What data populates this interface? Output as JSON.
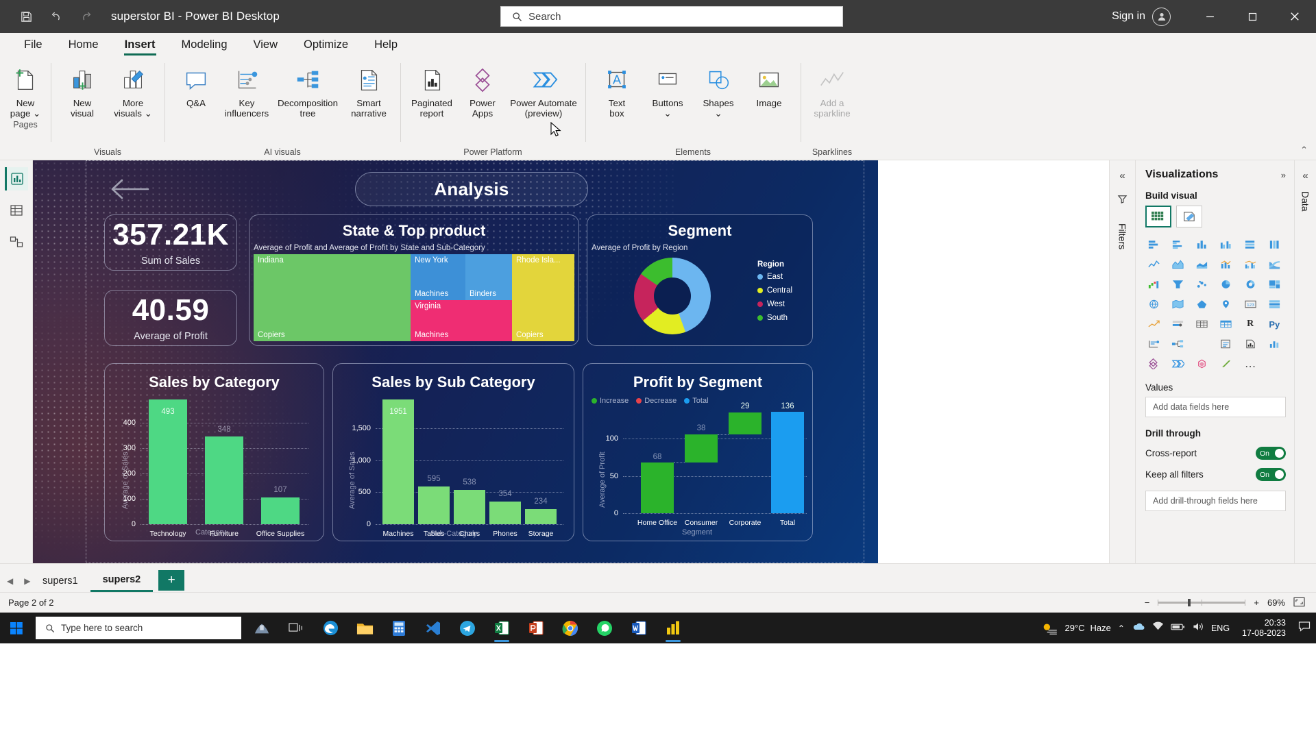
{
  "titlebar": {
    "save_icon": "save-icon",
    "undo_icon": "undo-icon",
    "redo_icon": "redo-icon",
    "title": "superstor BI - Power BI Desktop",
    "search_placeholder": "Search",
    "sign_in": "Sign in",
    "minimize": "minimize-button",
    "maximize": "maximize-button",
    "close": "close-button"
  },
  "ribbon": {
    "tabs": [
      {
        "label": "File",
        "active": false
      },
      {
        "label": "Home",
        "active": false
      },
      {
        "label": "Insert",
        "active": true
      },
      {
        "label": "Modeling",
        "active": false
      },
      {
        "label": "View",
        "active": false
      },
      {
        "label": "Optimize",
        "active": false
      },
      {
        "label": "Help",
        "active": false
      }
    ],
    "groups": [
      {
        "name": "Pages",
        "items": [
          {
            "label": "New\npage ⌄",
            "icon": "new-page-icon"
          }
        ]
      },
      {
        "name": "Visuals",
        "items": [
          {
            "label": "New\nvisual",
            "icon": "new-visual-icon"
          },
          {
            "label": "More\nvisuals ⌄",
            "icon": "more-visuals-icon"
          }
        ]
      },
      {
        "name": "AI visuals",
        "items": [
          {
            "label": "Q&A",
            "icon": "qa-icon"
          },
          {
            "label": "Key\ninfluencers",
            "icon": "key-influencers-icon"
          },
          {
            "label": "Decomposition\ntree",
            "icon": "decomposition-tree-icon"
          },
          {
            "label": "Smart\nnarrative",
            "icon": "smart-narrative-icon"
          }
        ]
      },
      {
        "name": "Power Platform",
        "items": [
          {
            "label": "Paginated\nreport",
            "icon": "paginated-report-icon"
          },
          {
            "label": "Power\nApps",
            "icon": "power-apps-icon"
          },
          {
            "label": "Power Automate\n(preview)",
            "icon": "power-automate-icon"
          }
        ]
      },
      {
        "name": "Elements",
        "items": [
          {
            "label": "Text\nbox",
            "icon": "text-box-icon"
          },
          {
            "label": "Buttons\n⌄",
            "icon": "buttons-icon"
          },
          {
            "label": "Shapes\n⌄",
            "icon": "shapes-icon"
          },
          {
            "label": "Image",
            "icon": "image-icon"
          }
        ]
      },
      {
        "name": "Sparklines",
        "items": [
          {
            "label": "Add a\nsparkline",
            "icon": "sparkline-icon",
            "disabled": true
          }
        ]
      }
    ]
  },
  "left_rail": [
    {
      "name": "report-view",
      "icon": "report-chart-icon",
      "active": true
    },
    {
      "name": "data-view",
      "icon": "table-grid-icon",
      "active": false
    },
    {
      "name": "model-view",
      "icon": "model-relationship-icon",
      "active": false
    }
  ],
  "report": {
    "banner_title": "Analysis",
    "back_button": "back-arrow-icon",
    "kpi_cards": [
      {
        "value": "357.21K",
        "label": "Sum of Sales"
      },
      {
        "value": "40.59",
        "label": "Average of Profit"
      }
    ],
    "treemap": {
      "title": "State & Top product",
      "subtitle": "Average of Profit and Average of Profit by State and Sub-Category",
      "tiles": [
        {
          "state": "Indiana",
          "product": "Copiers",
          "color": "#6cc767"
        },
        {
          "state": "New York",
          "product": "Machines",
          "color": "#3d90d7"
        },
        {
          "state": "",
          "product": "Binders",
          "color": "#4c9fdf"
        },
        {
          "state": "Rhode Isla...",
          "product": "Copiers",
          "color": "#e3d53b"
        },
        {
          "state": "Virginia",
          "product": "Machines",
          "color": "#ef2d73"
        }
      ]
    },
    "donut": {
      "title": "Segment",
      "subtitle": "Average of Profit by Region",
      "legend_title": "Region",
      "legend": [
        {
          "label": "East",
          "color": "#6cb6f0"
        },
        {
          "label": "Central",
          "color": "#e2ed22"
        },
        {
          "label": "West",
          "color": "#c6245c"
        },
        {
          "label": "South",
          "color": "#3cbd2e"
        }
      ]
    },
    "sales_by_category": {
      "title": "Sales by Category",
      "xlabel": "Category",
      "ylabel": "Average of Sales",
      "yticks": [
        "0",
        "100",
        "200",
        "300",
        "400"
      ],
      "categories": [
        "Technology",
        "Furniture",
        "Office Supplies"
      ],
      "values": [
        493,
        348,
        107
      ]
    },
    "sales_by_subcategory": {
      "title": "Sales by Sub Category",
      "xlabel": "Sub-Category",
      "ylabel": "Average of Sales",
      "yticks": [
        "0",
        "500",
        "1,000",
        "1,500"
      ],
      "categories": [
        "Machines",
        "Tables",
        "Chairs",
        "Phones",
        "Storage"
      ],
      "values": [
        1951,
        595,
        538,
        354,
        234
      ]
    },
    "profit_by_segment": {
      "title": "Profit by Segment",
      "xlabel": "Segment",
      "ylabel": "Average of Profit",
      "yticks": [
        "0",
        "50",
        "100"
      ],
      "legend": [
        {
          "label": "Increase",
          "color": "#2bb32b"
        },
        {
          "label": "Decrease",
          "color": "#e8424a"
        },
        {
          "label": "Total",
          "color": "#1b9df0"
        }
      ],
      "categories": [
        "Home Office",
        "Consumer",
        "Corporate",
        "Total"
      ],
      "values": [
        68,
        38,
        29,
        136
      ]
    }
  },
  "chart_data": [
    {
      "type": "bar",
      "title": "Sales by Category",
      "xlabel": "Category",
      "ylabel": "Average of Sales",
      "categories": [
        "Technology",
        "Furniture",
        "Office Supplies"
      ],
      "values": [
        493,
        348,
        107
      ],
      "ylim": [
        0,
        493
      ],
      "yticks": [
        0,
        100,
        200,
        300,
        400
      ],
      "grid": true,
      "legend": "none",
      "series_color": "#4ed884"
    },
    {
      "type": "bar",
      "title": "Sales by Sub Category",
      "xlabel": "Sub-Category",
      "ylabel": "Average of Sales",
      "categories": [
        "Machines",
        "Tables",
        "Chairs",
        "Phones",
        "Storage"
      ],
      "values": [
        1951,
        595,
        538,
        354,
        234
      ],
      "ylim": [
        0,
        1951
      ],
      "yticks": [
        0,
        500,
        1000,
        1500
      ],
      "grid": true,
      "legend": "none",
      "series_color": "#7bdc78"
    },
    {
      "type": "bar",
      "title": "Profit by Segment",
      "subtype": "waterfall",
      "xlabel": "Segment",
      "ylabel": "Average of Profit",
      "categories": [
        "Home Office",
        "Consumer",
        "Corporate",
        "Total"
      ],
      "values": [
        68,
        38,
        29,
        136
      ],
      "cumulative_base": [
        0,
        68,
        106,
        0
      ],
      "ylim": [
        0,
        136
      ],
      "yticks": [
        0,
        50,
        100
      ],
      "grid": true,
      "legend": [
        "Increase",
        "Decrease",
        "Total"
      ],
      "legend_position": "top-left"
    },
    {
      "type": "pie",
      "subtype": "donut",
      "title": "Segment",
      "subtitle": "Average of Profit by Region",
      "legend_title": "Region",
      "categories": [
        "East",
        "Central",
        "West",
        "South"
      ],
      "values": [
        45,
        20,
        22,
        13
      ],
      "colors": [
        "#6cb6f0",
        "#e2ed22",
        "#c6245c",
        "#3cbd2e"
      ],
      "legend_position": "right"
    },
    {
      "type": "heatmap",
      "subtype": "treemap",
      "title": "State & Top product",
      "subtitle": "Average of Profit and Average of Profit by State and Sub-Category",
      "categories": [
        "Indiana / Copiers",
        "New York / Machines",
        "New York / Binders",
        "Rhode Isla... / Copiers",
        "Virginia / Machines"
      ],
      "values": [
        44,
        16,
        12,
        14,
        14
      ],
      "colors": [
        "#6cc767",
        "#3d90d7",
        "#4c9fdf",
        "#e3d53b",
        "#ef2d73"
      ]
    }
  ],
  "right_strip": {
    "collapse_icon": "chevron-double-left-icon",
    "filter_icon": "filter-icon",
    "filters_label": "Filters"
  },
  "visualizations": {
    "title": "Visualizations",
    "expand_icon": "chevron-double-right-icon",
    "build_visual": "Build visual",
    "values_label": "Values",
    "values_placeholder": "Add data fields here",
    "drill_through_label": "Drill through",
    "cross_report_label": "Cross-report",
    "cross_report_state": "On",
    "keep_filters_label": "Keep all filters",
    "keep_filters_state": "On",
    "drill_placeholder": "Add drill-through fields here",
    "gallery_icons": [
      "stacked-bar-chart-icon",
      "clustered-bar-chart-icon",
      "stacked-column-chart-icon",
      "clustered-column-chart-icon",
      "100-stacked-bar-icon",
      "100-stacked-column-icon",
      "line-chart-icon",
      "area-chart-icon",
      "stacked-area-chart-icon",
      "line-stacked-column-icon",
      "line-clustered-column-icon",
      "ribbon-chart-icon",
      "waterfall-chart-icon",
      "funnel-chart-icon",
      "scatter-chart-icon",
      "pie-chart-icon",
      "donut-chart-icon",
      "treemap-icon",
      "map-icon",
      "filled-map-icon",
      "shape-map-icon",
      "azure-map-icon",
      "card-icon",
      "multi-row-card-icon",
      "kpi-icon",
      "slicer-icon",
      "table-icon",
      "matrix-icon",
      "r-script-visual-icon",
      "python-visual-icon",
      "key-influencers-icon",
      "decomposition-tree-icon",
      "qa-visual-icon",
      "smart-narrative-icon",
      "paginated-report-icon",
      "metrics-icon",
      "power-apps-icon",
      "power-automate-icon",
      "scatter-hex-icon",
      "arrow-visual-icon",
      "more-options-icon"
    ]
  },
  "data_pane": {
    "label": "Data",
    "collapse_icon": "chevron-double-left-icon"
  },
  "page_tabs": {
    "prev_icon": "prev-page-icon",
    "next_icon": "next-page-icon",
    "tabs": [
      {
        "label": "supers1",
        "active": false
      },
      {
        "label": "supers2",
        "active": true
      }
    ],
    "add_label": "+"
  },
  "statusbar": {
    "page_status": "Page 2 of 2",
    "zoom_out": "−",
    "zoom_in": "+",
    "zoom_level": "69%",
    "fit_icon": "fit-to-page-icon"
  },
  "taskbar": {
    "start": "windows-start-icon",
    "search_placeholder": "Type here to search",
    "task_view": "task-view-icon",
    "apps": [
      "cortana-icon",
      "edge-icon",
      "file-explorer-icon",
      "calculator-icon",
      "vscode-icon",
      "telegram-icon",
      "excel-icon",
      "powerpoint-icon",
      "chrome-icon",
      "whatsapp-icon",
      "word-icon",
      "powerbi-icon"
    ],
    "weather_temp": "29°C",
    "weather_desc": "Haze",
    "weather_icon": "haze-icon",
    "tray_icons": [
      "chevron-up-icon",
      "onedrive-icon",
      "network-icon",
      "battery-icon",
      "volume-icon"
    ],
    "language": "ENG",
    "time": "20:33",
    "date": "17-08-2023",
    "notification": "notification-icon"
  }
}
